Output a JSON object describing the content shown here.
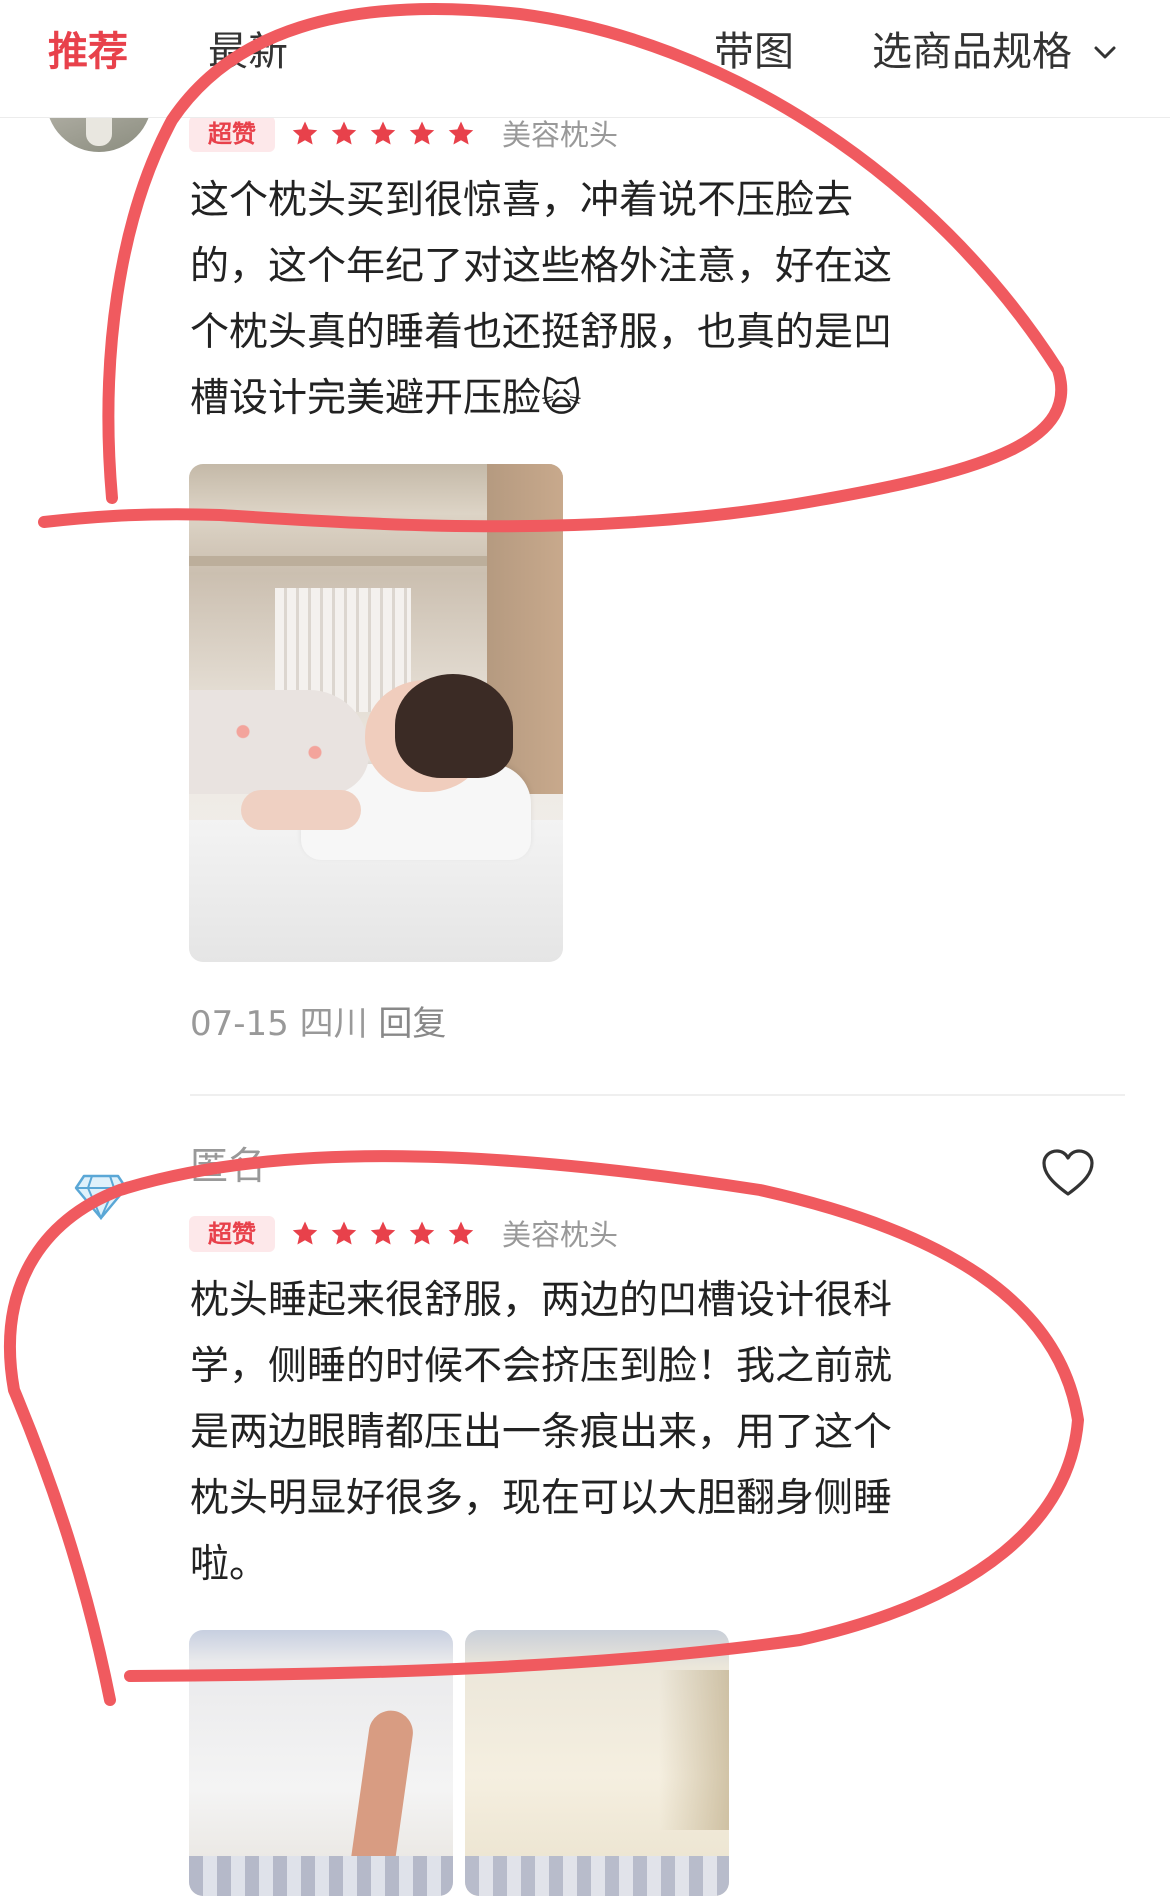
{
  "tabs": {
    "recommend": "推荐",
    "latest": "最新",
    "with_image": "带图",
    "select_spec": "选商品规格"
  },
  "reviews": [
    {
      "badge": "超赞",
      "rating": 5,
      "spec": "美容枕头",
      "text": "这个枕头买到很惊喜，冲着说不压脸去的，这个年纪了对这些格外注意，好在这个枕头真的睡着也还挺舒服，也真的是凹槽设计完美避开压脸🙀",
      "date": "07-15",
      "location": "四川",
      "reply": "回复"
    },
    {
      "username": "匿名",
      "badge": "超赞",
      "rating": 5,
      "spec": "美容枕头",
      "text": "枕头睡起来很舒服，两边的凹槽设计很科学，侧睡的时候不会挤压到脸！我之前就是两边眼睛都压出一条痕出来，用了这个枕头明显好很多，现在可以大胆翻身侧睡啦。"
    }
  ],
  "colors": {
    "accent": "#e8414b",
    "star": "#e8414b",
    "markup": "#f05a5f"
  },
  "icons": [
    "chevron-down-icon",
    "star-icon",
    "diamond-icon",
    "heart-icon"
  ]
}
